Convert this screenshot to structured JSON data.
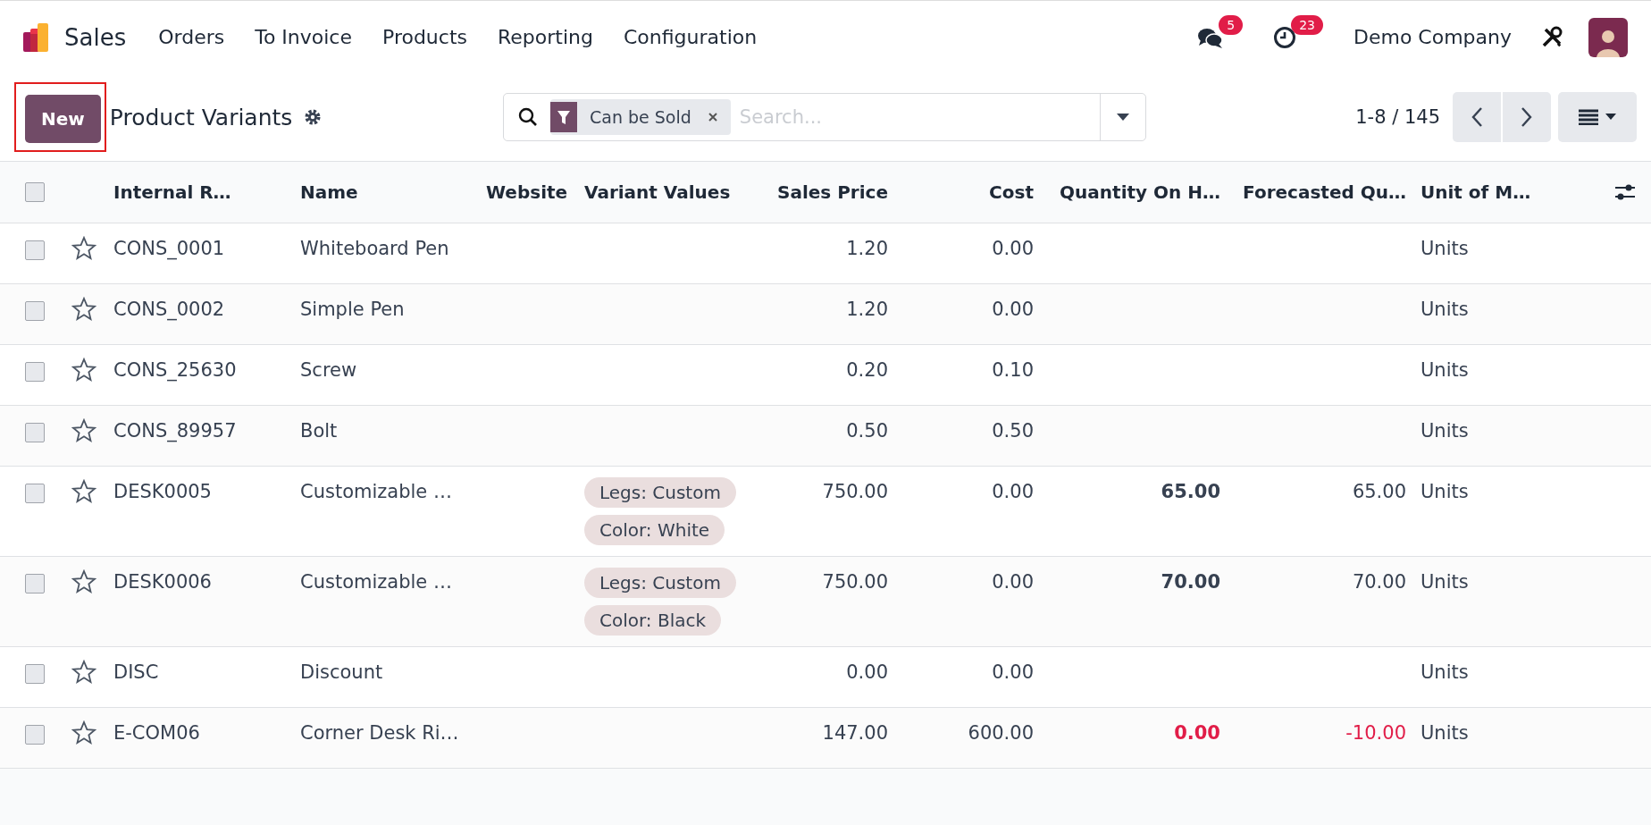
{
  "navbar": {
    "app": "Sales",
    "menu": [
      "Orders",
      "To Invoice",
      "Products",
      "Reporting",
      "Configuration"
    ],
    "messages_count": "5",
    "activities_count": "23",
    "company": "Demo Company"
  },
  "control_panel": {
    "new_button": "New",
    "title": "Product Variants",
    "search": {
      "facet": "Can be Sold",
      "placeholder": "Search..."
    },
    "pager": "1-8 / 145"
  },
  "table": {
    "select_all": {
      "checked": false
    },
    "columns": [
      {
        "label": "Internal R…",
        "kind": "text"
      },
      {
        "label": "Name",
        "kind": "text"
      },
      {
        "label": "Website",
        "kind": "text"
      },
      {
        "label": "Variant Values",
        "kind": "text"
      },
      {
        "label": "Sales Price",
        "kind": "number"
      },
      {
        "label": "Cost",
        "kind": "number"
      },
      {
        "label": "Quantity On H…",
        "kind": "number"
      },
      {
        "label": "Forecasted Qu…",
        "kind": "number"
      },
      {
        "label": "Unit of M…",
        "kind": "text"
      }
    ],
    "rows": [
      {
        "checked": false,
        "favorite": false,
        "ref": "CONS_0001",
        "name": "Whiteboard Pen",
        "sales_price": "1.20",
        "cost": "0.00",
        "uom": "Units"
      },
      {
        "checked": false,
        "favorite": false,
        "ref": "CONS_0002",
        "name": "Simple Pen",
        "sales_price": "1.20",
        "cost": "0.00",
        "uom": "Units"
      },
      {
        "checked": false,
        "favorite": false,
        "ref": "CONS_25630",
        "name": "Screw",
        "sales_price": "0.20",
        "cost": "0.10",
        "uom": "Units"
      },
      {
        "checked": false,
        "favorite": false,
        "ref": "CONS_89957",
        "name": "Bolt",
        "sales_price": "0.50",
        "cost": "0.50",
        "uom": "Units"
      },
      {
        "checked": false,
        "favorite": false,
        "warning": false,
        "ref": "DESK0005",
        "name": "Customizable …",
        "variants": [
          "Legs: Custom",
          "Color: White"
        ],
        "sales_price": "750.00",
        "cost": "0.00",
        "qty": "65.00",
        "forecast": "65.00",
        "uom": "Units"
      },
      {
        "checked": false,
        "favorite": false,
        "warning": false,
        "ref": "DESK0006",
        "name": "Customizable …",
        "variants": [
          "Legs: Custom",
          "Color: Black"
        ],
        "sales_price": "750.00",
        "cost": "0.00",
        "qty": "70.00",
        "forecast": "70.00",
        "uom": "Units"
      },
      {
        "checked": false,
        "favorite": false,
        "ref": "DISC",
        "name": "Discount",
        "sales_price": "0.00",
        "cost": "0.00",
        "uom": "Units"
      },
      {
        "checked": false,
        "favorite": false,
        "warning": true,
        "ref": "E-COM06",
        "name": "Corner Desk Ri…",
        "sales_price": "147.00",
        "cost": "600.00",
        "qty": "0.00",
        "forecast": "-10.00",
        "uom": "Units"
      }
    ]
  }
}
